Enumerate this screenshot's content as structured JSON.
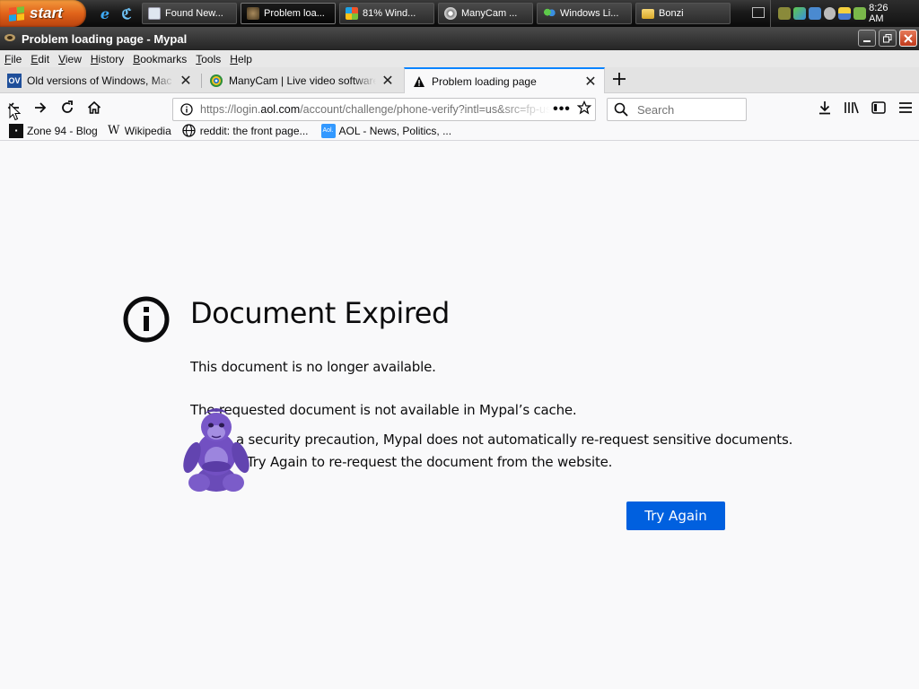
{
  "taskbar": {
    "start_label": "start",
    "tasks": [
      {
        "label": "Found New...",
        "active": false
      },
      {
        "label": "Problem loa...",
        "active": true
      },
      {
        "label": "81% Wind...",
        "active": false
      },
      {
        "label": "ManyCam ...",
        "active": false
      },
      {
        "label": "Windows Li...",
        "active": false
      },
      {
        "label": "Bonzi",
        "active": false
      }
    ],
    "clock": "8:26 AM"
  },
  "window": {
    "title": "Problem loading page - Mypal"
  },
  "menu": [
    {
      "u": "F",
      "rest": "ile"
    },
    {
      "u": "E",
      "rest": "dit"
    },
    {
      "u": "V",
      "rest": "iew"
    },
    {
      "u": "H",
      "rest": "istory"
    },
    {
      "u": "B",
      "rest": "ookmarks"
    },
    {
      "u": "T",
      "rest": "ools"
    },
    {
      "u": "H",
      "rest": "elp"
    }
  ],
  "tabs": [
    {
      "label": "Old versions of Windows, Mac and Linux",
      "favicon": "OV"
    },
    {
      "label": "ManyCam | Live video software & webcam effects",
      "favicon": "manycam"
    },
    {
      "label": "Problem loading page",
      "favicon": "warning"
    }
  ],
  "navbar": {
    "url_prefix": "https://login.",
    "url_domain": "aol.com",
    "url_rest": "/account/challenge/phone-verify?intl=us&src=fp-us&lang=en-US",
    "search_placeholder": "Search"
  },
  "bookmarks": [
    {
      "label": "Zone 94 - Blog",
      "icon": "zone94"
    },
    {
      "label": "Wikipedia",
      "icon": "W"
    },
    {
      "label": "reddit: the front page...",
      "icon": "globe"
    },
    {
      "label": "AOL - News, Politics, ...",
      "icon": "Aol."
    }
  ],
  "error": {
    "title": "Document Expired",
    "line1": "This document is no longer available.",
    "line2": "The requested document is not available in Mypal’s cache.",
    "item1": "a security precaution, Mypal does not automatically re-request sensitive documents.",
    "item2": "Try Again to re-request the document from the website.",
    "button": "Try Again"
  },
  "colors": {
    "accent": "#0060df",
    "tab_highlight": "#0a84ff",
    "start_orange": "#e0631a"
  }
}
